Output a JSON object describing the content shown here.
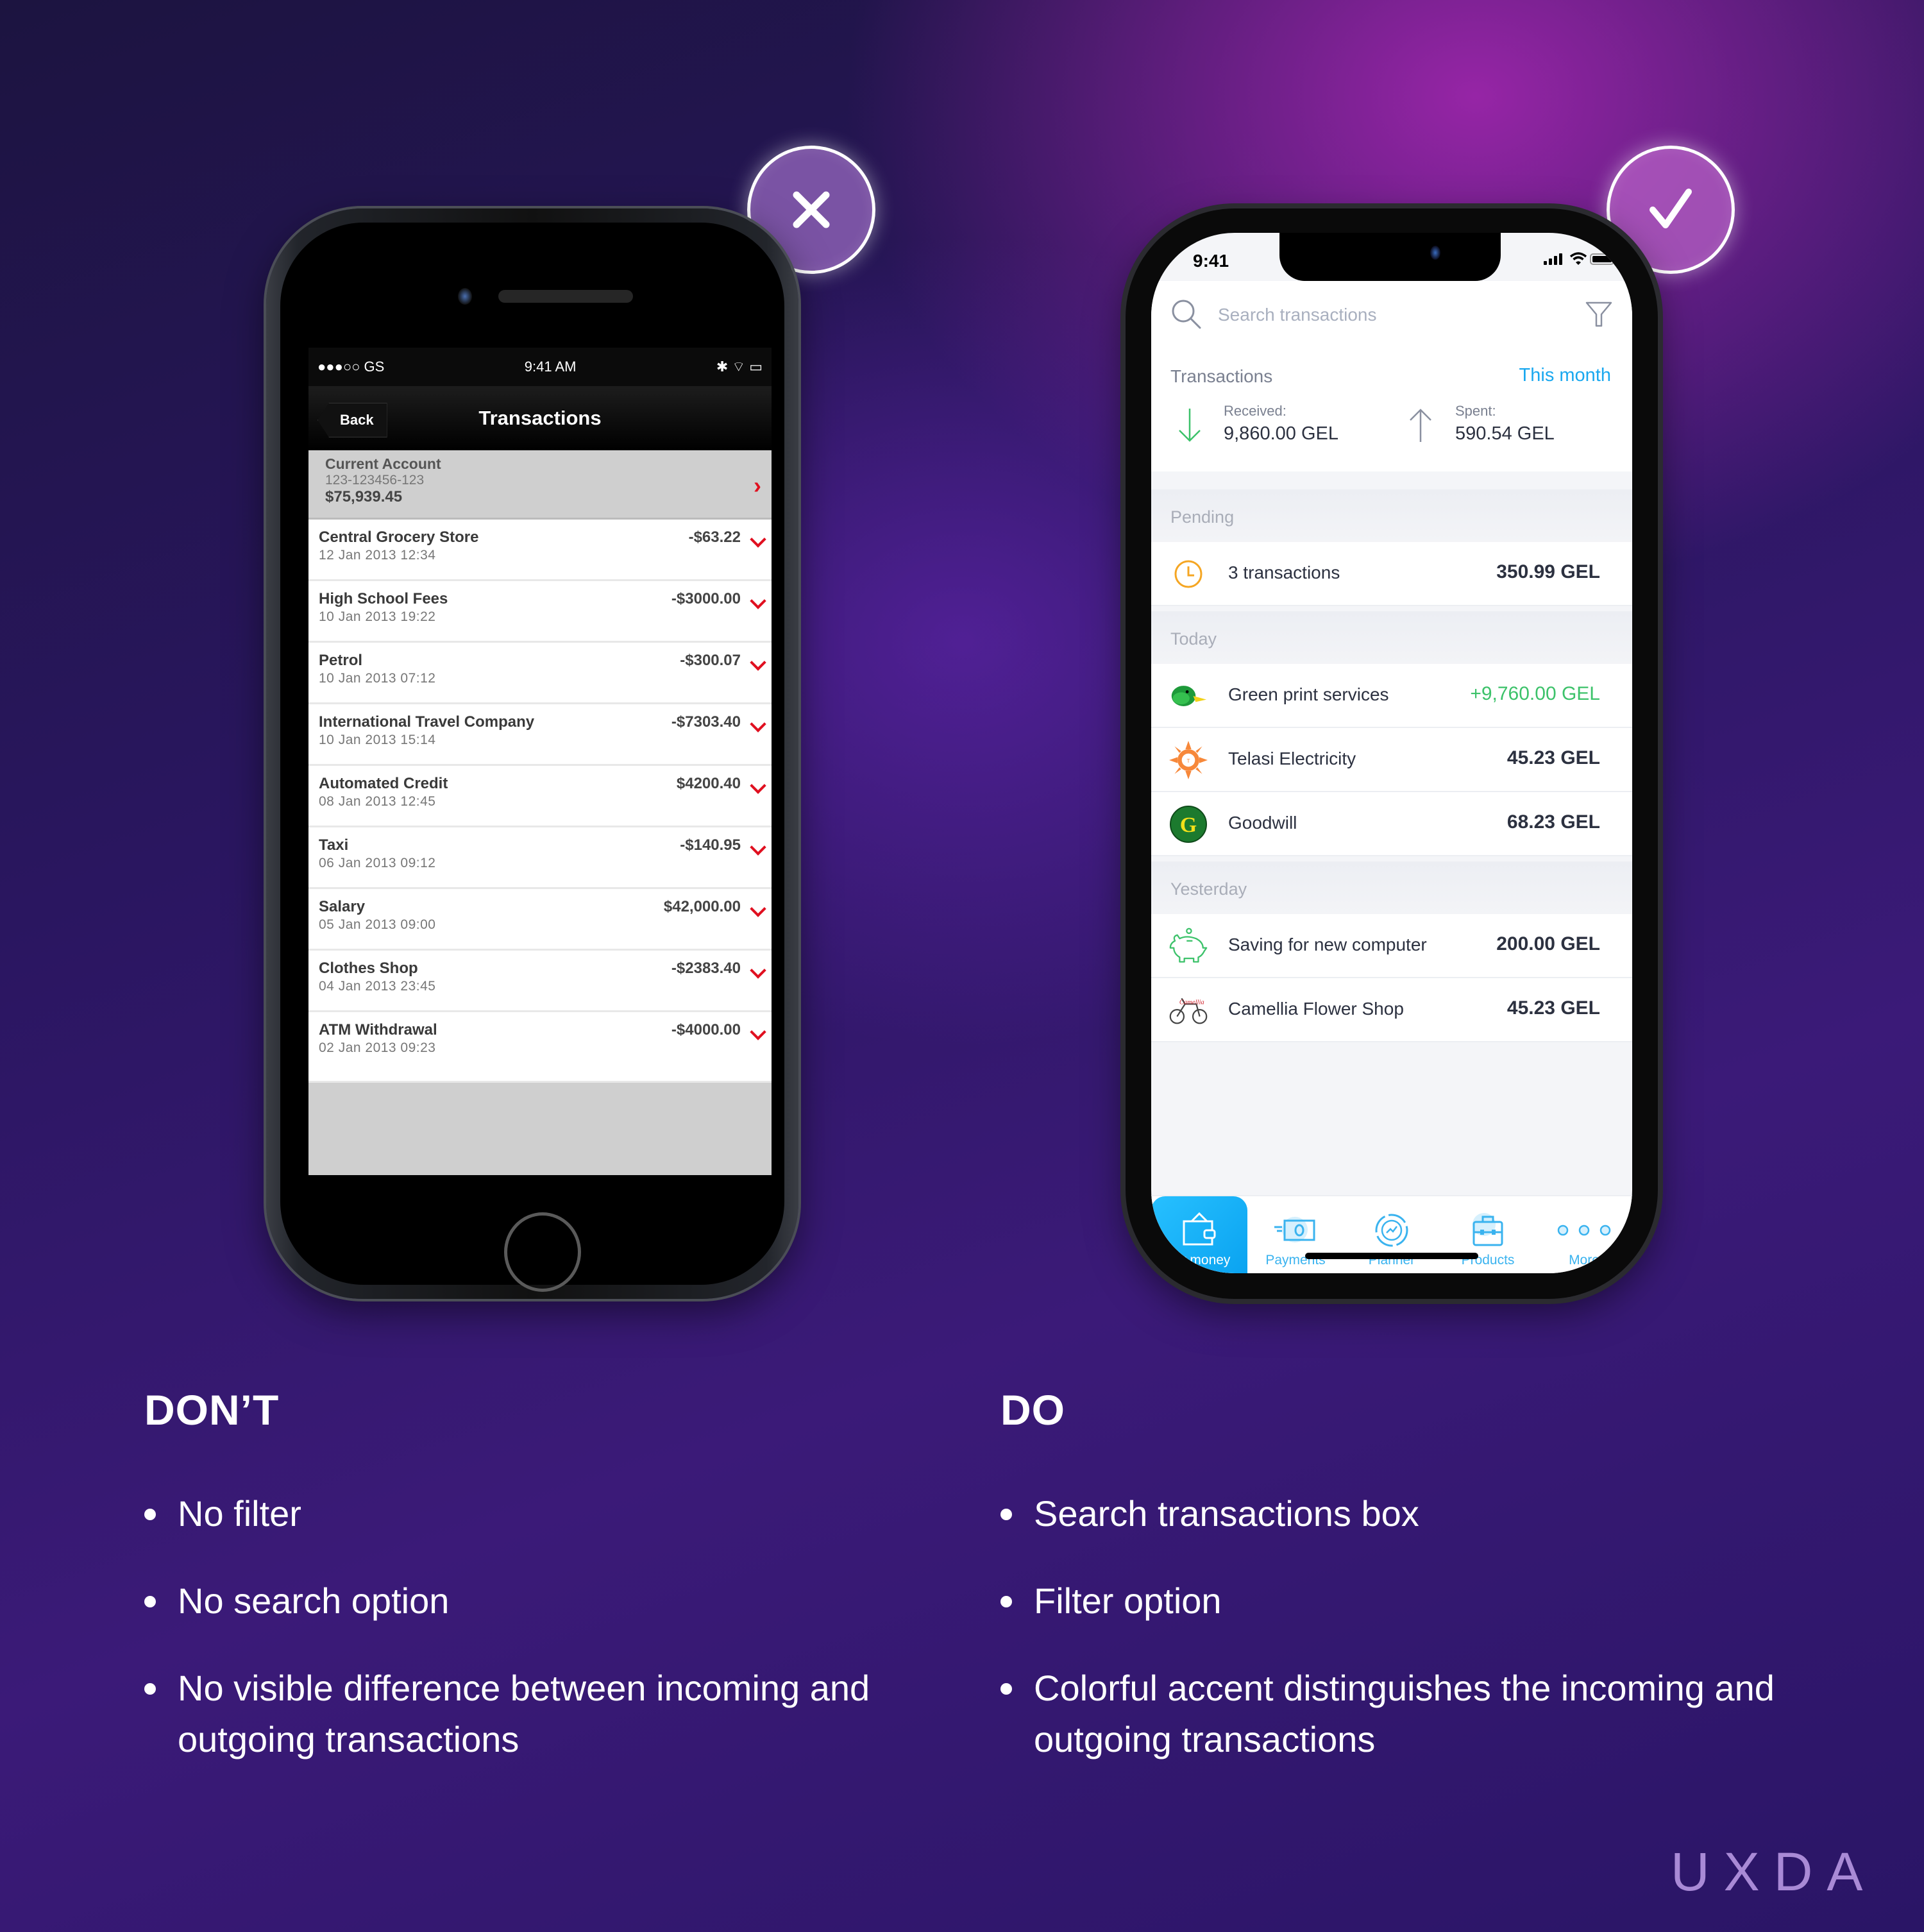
{
  "badges": {
    "dont": "close-x",
    "do": "checkmark"
  },
  "old_app": {
    "status": {
      "carrier": "●●●○○ GS",
      "time": "9:41 AM",
      "icons": "✱ ⌔ ▭"
    },
    "nav": {
      "back_label": "Back",
      "title": "Transactions"
    },
    "account": {
      "name": "Current Account",
      "number": "123-123456-123",
      "balance": "$75,939.45"
    },
    "transactions": [
      {
        "name": "Central Grocery Store",
        "date": "12 Jan 2013 12:34",
        "amount": "-$63.22"
      },
      {
        "name": "High School Fees",
        "date": "10 Jan 2013 19:22",
        "amount": "-$3000.00"
      },
      {
        "name": "Petrol",
        "date": "10 Jan 2013 07:12",
        "amount": "-$300.07"
      },
      {
        "name": "International Travel Company",
        "date": "10 Jan 2013 15:14",
        "amount": "-$7303.40"
      },
      {
        "name": "Automated Credit",
        "date": "08 Jan 2013 12:45",
        "amount": "$4200.40"
      },
      {
        "name": "Taxi",
        "date": "06 Jan 2013 09:12",
        "amount": "-$140.95"
      },
      {
        "name": "Salary",
        "date": "05 Jan 2013 09:00",
        "amount": "$42,000.00"
      },
      {
        "name": "Clothes Shop",
        "date": "04 Jan 2013 23:45",
        "amount": "-$2383.40"
      },
      {
        "name": "ATM Withdrawal",
        "date": "02 Jan 2013 09:23",
        "amount": "-$4000.00"
      }
    ]
  },
  "new_app": {
    "status": {
      "time": "9:41"
    },
    "search": {
      "placeholder": "Search transactions",
      "value": ""
    },
    "summary": {
      "title": "Transactions",
      "period": "This month",
      "received_label": "Received:",
      "received_value": "9,860.00 GEL",
      "spent_label": "Spent:",
      "spent_value": "590.54 GEL"
    },
    "sections": {
      "pending": {
        "label": "Pending",
        "row": {
          "name": "3 transactions",
          "amount": "350.99 GEL"
        }
      },
      "today": {
        "label": "Today",
        "rows": [
          {
            "name": "Green print services",
            "amount": "+9,760.00 GEL",
            "icon": "duck-logo"
          },
          {
            "name": "Telasi Electricity",
            "amount": "45.23 GEL",
            "icon": "sun-logo"
          },
          {
            "name": "Goodwill",
            "amount": "68.23 GEL",
            "icon": "goodwill-logo"
          }
        ]
      },
      "yesterday": {
        "label": "Yesterday",
        "rows": [
          {
            "name": "Saving for new computer",
            "amount": "200.00 GEL",
            "icon": "piggy-bank"
          },
          {
            "name": "Camellia Flower Shop",
            "amount": "45.23 GEL",
            "icon": "bicycle-logo"
          }
        ]
      }
    },
    "tabs": [
      {
        "label": "My money",
        "active": true
      },
      {
        "label": "Payments"
      },
      {
        "label": "Planner"
      },
      {
        "label": "Products"
      },
      {
        "label": "More"
      }
    ],
    "colors": {
      "accent": "#1aa8ef",
      "income": "#3cc26a",
      "pending": "#f5a623"
    }
  },
  "captions": {
    "dont": {
      "heading": "DON’T",
      "points": [
        "No filter",
        "No search option",
        "No visible difference between incoming and outgoing transactions"
      ]
    },
    "do": {
      "heading": "DO",
      "points": [
        "Search transactions box",
        "Filter option",
        "Colorful accent distinguishes the incoming and outgoing transactions"
      ]
    }
  },
  "brand": {
    "logo": "UXDA"
  }
}
